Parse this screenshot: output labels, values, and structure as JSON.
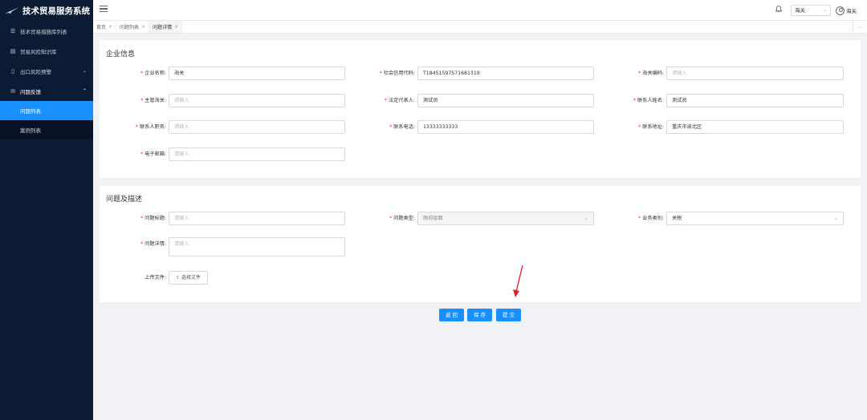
{
  "app": {
    "title": "技术贸易服务系统"
  },
  "sidebar": {
    "items": [
      {
        "label": "技术贸易措施库列表",
        "icon": "list-icon"
      },
      {
        "label": "贸易风险知识库",
        "icon": "book-icon"
      },
      {
        "label": "出口风险预警",
        "icon": "warning-doc-icon"
      },
      {
        "label": "问题反馈",
        "icon": "mail-icon"
      }
    ],
    "subitems": [
      {
        "label": "问题列表",
        "active": true
      },
      {
        "label": "案例列表",
        "active": false
      }
    ]
  },
  "header": {
    "org_select": "海关",
    "user_name": "海关"
  },
  "tabs": [
    {
      "label": "首页"
    },
    {
      "label": "问题列表"
    },
    {
      "label": "问题详情",
      "active": true
    }
  ],
  "company": {
    "title": "企业信息",
    "fields": {
      "company_name": {
        "label": "企业名称:",
        "value": "海关"
      },
      "credit_code": {
        "label": "社会信用代码:",
        "value": "T18451597571681319"
      },
      "customs_code": {
        "label": "海关编码:",
        "placeholder": "请输入"
      },
      "supervising_customs": {
        "label": "主管海关:",
        "placeholder": "请输入"
      },
      "legal_rep": {
        "label": "法定代表人:",
        "value": "测试员"
      },
      "contact_name": {
        "label": "联系人姓名:",
        "value": "测试员"
      },
      "contact_position": {
        "label": "联系人职务:",
        "placeholder": "请输入"
      },
      "phone": {
        "label": "联系电话:",
        "value": "13333333333"
      },
      "address": {
        "label": "联系地址:",
        "value": "重庆市渝北区"
      },
      "email": {
        "label": "电子邮箱:",
        "placeholder": "请输入"
      }
    }
  },
  "problem": {
    "title": "问题及描述",
    "fields": {
      "problem_title": {
        "label": "问题标题:",
        "placeholder": "请输入"
      },
      "problem_type": {
        "label": "问题类型:",
        "value": "政府层面"
      },
      "business_category": {
        "label": "业务类别:",
        "value": "关税"
      },
      "problem_detail": {
        "label": "问题详情:",
        "placeholder": "请输入"
      },
      "upload": {
        "label": "上传文件:",
        "button": "选择文件"
      }
    }
  },
  "actions": {
    "back": "返 回",
    "save": "保 存",
    "submit": "提 交"
  },
  "colors": {
    "sidebar": "#0b1b33",
    "accent": "#1890ff",
    "required": "#f5222d"
  }
}
